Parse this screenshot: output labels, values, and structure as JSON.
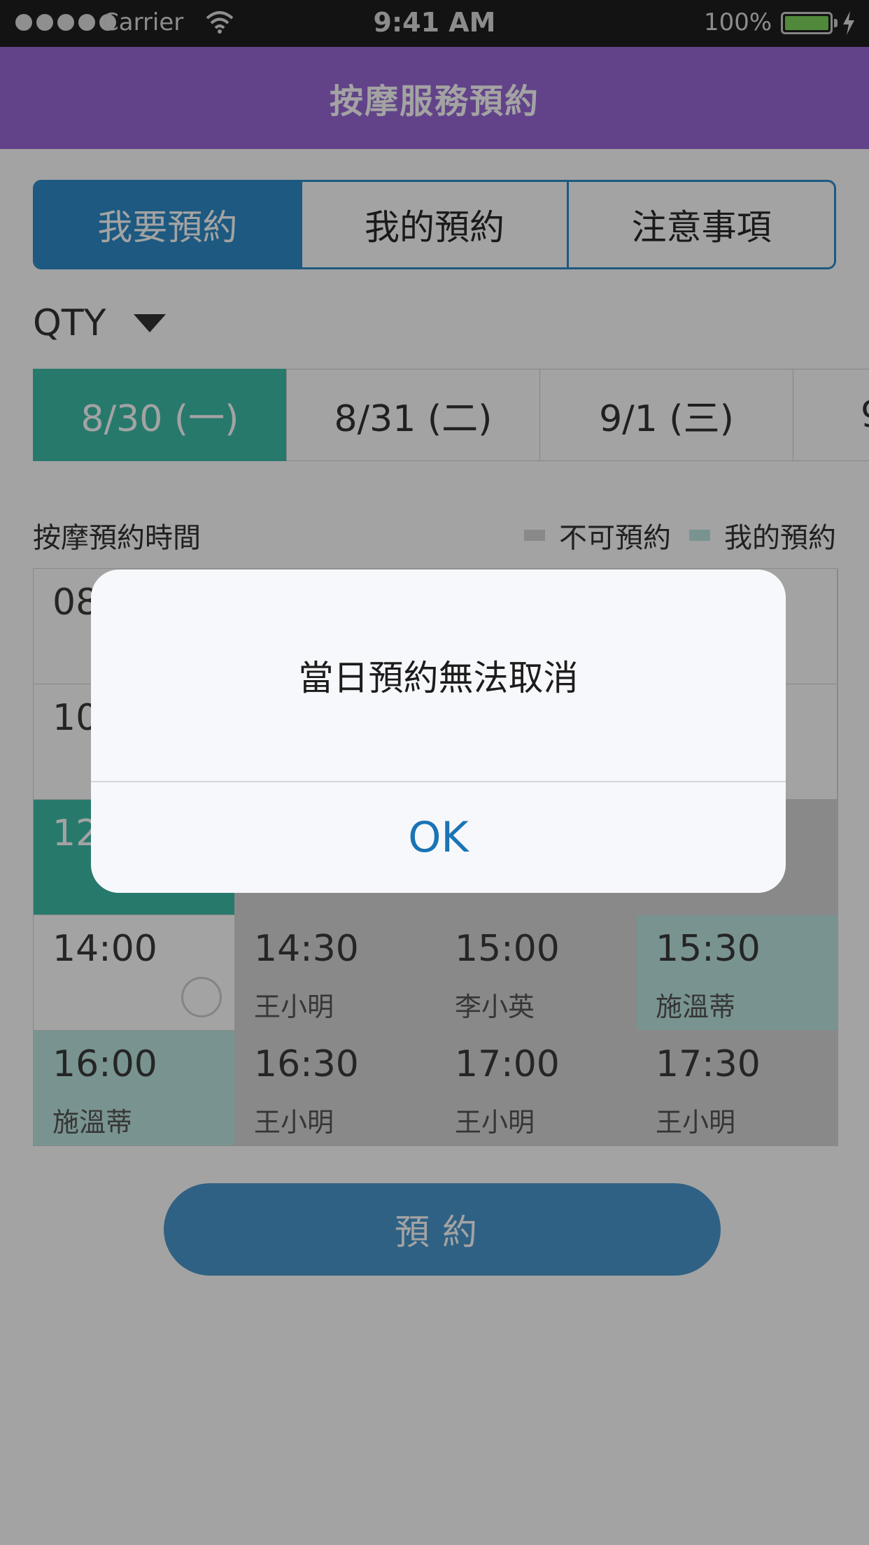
{
  "status_bar": {
    "carrier": "Carrier",
    "time": "9:41 AM",
    "battery": "100%"
  },
  "header": {
    "title": "按摩服務預約"
  },
  "tabs": [
    {
      "label": "我要預約",
      "active": true
    },
    {
      "label": "我的預約",
      "active": false
    },
    {
      "label": "注意事項",
      "active": false
    }
  ],
  "location": {
    "value": "QTY"
  },
  "dates": [
    {
      "label": "8/30 (一)",
      "active": true
    },
    {
      "label": "8/31 (二)",
      "active": false
    },
    {
      "label": "9/1 (三)",
      "active": false
    },
    {
      "label": "9",
      "active": false
    }
  ],
  "section": {
    "label": "按摩預約時間"
  },
  "legend": {
    "unavailable": {
      "label": "不可預約",
      "color": "#d6d6d6"
    },
    "mine": {
      "label": "我的預約",
      "color": "#bee8e1"
    }
  },
  "slots": [
    {
      "time": "08",
      "name": "",
      "state": "free"
    },
    {
      "time": "10",
      "name": "",
      "state": "free"
    },
    {
      "time": "12",
      "name": "",
      "state": "selected"
    },
    {
      "time": "14:00",
      "name": "",
      "state": "free"
    },
    {
      "time": "14:30",
      "name": "王小明",
      "state": "taken"
    },
    {
      "time": "15:00",
      "name": "李小英",
      "state": "taken"
    },
    {
      "time": "15:30",
      "name": "施溫蒂",
      "state": "mine"
    },
    {
      "time": "16:00",
      "name": "施溫蒂",
      "state": "mine"
    },
    {
      "time": "16:30",
      "name": "王小明",
      "state": "taken"
    },
    {
      "time": "17:00",
      "name": "王小明",
      "state": "taken"
    },
    {
      "time": "17:30",
      "name": "王小明",
      "state": "taken"
    }
  ],
  "book_button": {
    "label": "預約"
  },
  "alert": {
    "message": "當日預約無法取消",
    "ok_label": "OK"
  },
  "colors": {
    "header": "#9a6ad6",
    "accent": "#2e8bc9",
    "selected": "#3dbdaa",
    "mine": "#bee8e1",
    "taken": "#d6d6d6"
  }
}
